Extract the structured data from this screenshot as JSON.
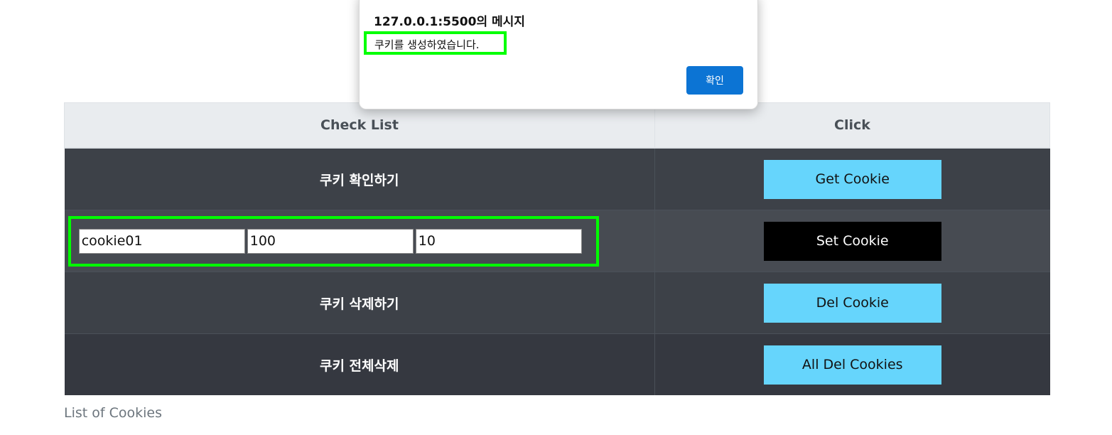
{
  "dialog": {
    "title": "127.0.0.1:5500의 메시지",
    "message": "쿠키를 생성하였습니다.",
    "ok_label": "확인"
  },
  "table": {
    "headers": [
      "Check List",
      "Click"
    ],
    "rows": [
      {
        "label": "쿠키 확인하기",
        "button": "Get Cookie"
      },
      {
        "inputs": [
          "cookie01",
          "100",
          "10"
        ],
        "button": "Set Cookie"
      },
      {
        "label": "쿠키 삭제하기",
        "button": "Del Cookie"
      },
      {
        "label": "쿠키 전체삭제",
        "button": "All Del Cookies"
      }
    ]
  },
  "caption": "List of Cookies",
  "colors": {
    "button_bg": "#66d5fc",
    "set_button_bg": "#000000",
    "highlight": "#00ff00",
    "dialog_ok_bg": "#0c74d4"
  }
}
